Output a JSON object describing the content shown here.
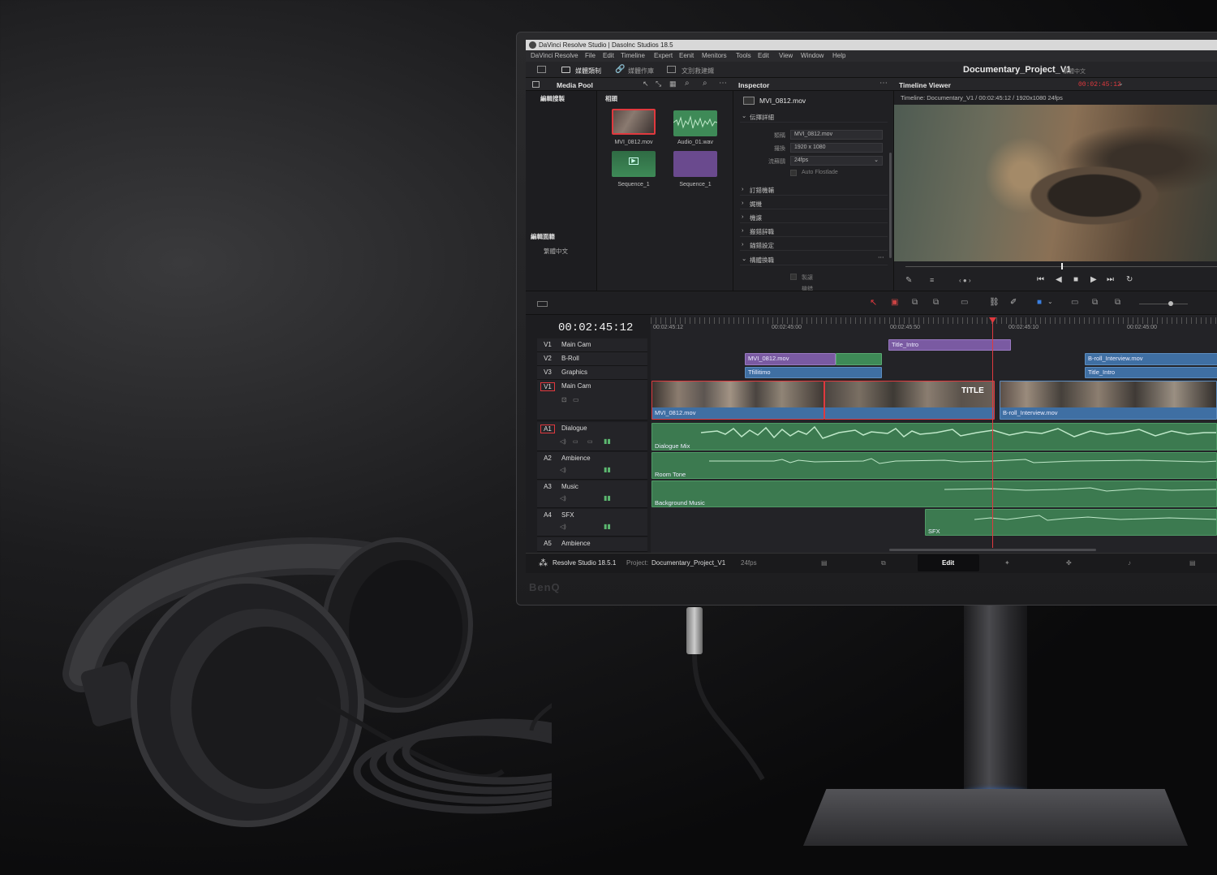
{
  "hardware": {
    "brand": "BenQ"
  },
  "app": {
    "window_title": "DaVinci Resolve Studio | Dasolnc Studios 18.5",
    "menu": [
      "DaVinci Resolve",
      "File",
      "Edit",
      "Timeline",
      "Expert",
      "Eenit",
      "Menitors",
      "Tools",
      "Edit",
      "View",
      "Window",
      "Help"
    ],
    "toolbar": {
      "items": [
        "媒體類制",
        "媒體作庫",
        "文別救建鐵"
      ]
    },
    "project_title": "Documentary_Project_V1",
    "project_lang": "繁體中文"
  },
  "media_pool": {
    "title": "Media Pool",
    "bin_header": "編輯搜製",
    "clips_header": "相頭",
    "side_label_1": "編輯面籍",
    "side_label_2": "繁體中文",
    "clips": [
      {
        "name": "MVI_0812.mov",
        "kind": "video"
      },
      {
        "name": "Audio_01.wav",
        "kind": "audio"
      },
      {
        "name": "Sequence_1",
        "kind": "sequence"
      },
      {
        "name": "Sequence_1",
        "kind": "title"
      }
    ]
  },
  "inspector": {
    "title": "Inspector",
    "clip_name": "MVI_0812.mov",
    "section_details": "伝揮詳細",
    "fields": [
      {
        "label": "類稱",
        "value": "MVI_0812.mov"
      },
      {
        "label": "撮換",
        "value": "1920 x 1080"
      },
      {
        "label": "流蘇鷗",
        "value": "24fps"
      }
    ],
    "checkbox_label": "Auto Flostlade",
    "sections": [
      "訂錯機輔",
      "娓機",
      "機譲",
      "搬錯辞職",
      "錨錯設定",
      "構體換職"
    ],
    "sub_items": [
      "製譲",
      "機錯"
    ]
  },
  "viewer": {
    "title": "Timeline Viewer",
    "timecode": "00:02:45:12",
    "info": "Timeline: Documentary_V1  /  00:02:45:12 / 1920x1080 24fps"
  },
  "timeline": {
    "timecode": "00:02:45:12",
    "ruler": [
      "00:02:45:12",
      "00:02:45:00",
      "00:02:45:50",
      "00:02:45:10",
      "00:02:45:00"
    ],
    "video_tracks": [
      {
        "id": "V1",
        "name": "Main Cam"
      },
      {
        "id": "V2",
        "name": "B-Roll"
      },
      {
        "id": "V3",
        "name": "Graphics"
      },
      {
        "id": "V1",
        "name": "Main Cam"
      }
    ],
    "audio_tracks": [
      {
        "id": "A1",
        "name": "Dialogue"
      },
      {
        "id": "A2",
        "name": "Ambience"
      },
      {
        "id": "A3",
        "name": "Music"
      },
      {
        "id": "A4",
        "name": "SFX"
      },
      {
        "id": "A5",
        "name": "Ambience"
      }
    ],
    "clips": {
      "title_intro_1": "Title_Intro",
      "broll_1": "MVI_0812.mov",
      "title_ultimo": "Tfillitimo",
      "broll_interview_top": "B-roll_Interview.mov",
      "title_intro_2": "Title_Intro",
      "main_1": "MVI_0812.mov",
      "main_title_text": "TITLE",
      "main_2": "B-roll_Interview.mov",
      "audio_dialogue": "Dialogue Mix",
      "audio_room": "Room Tone",
      "audio_music": "Background Music",
      "audio_sfx": "SFX"
    }
  },
  "statusbar": {
    "app_version": "Resolve Studio 18.5.1",
    "project_label": "Project:",
    "project_name": "Documentary_Project_V1",
    "fps": "24fps",
    "active_page": "Edit"
  },
  "colors": {
    "accent_red": "#e0393e",
    "video_clip": "#3f6fa3",
    "title_clip": "#7a5aa2",
    "audio_clip": "#3c7a50",
    "stand_ring": "#1e6fe0"
  }
}
